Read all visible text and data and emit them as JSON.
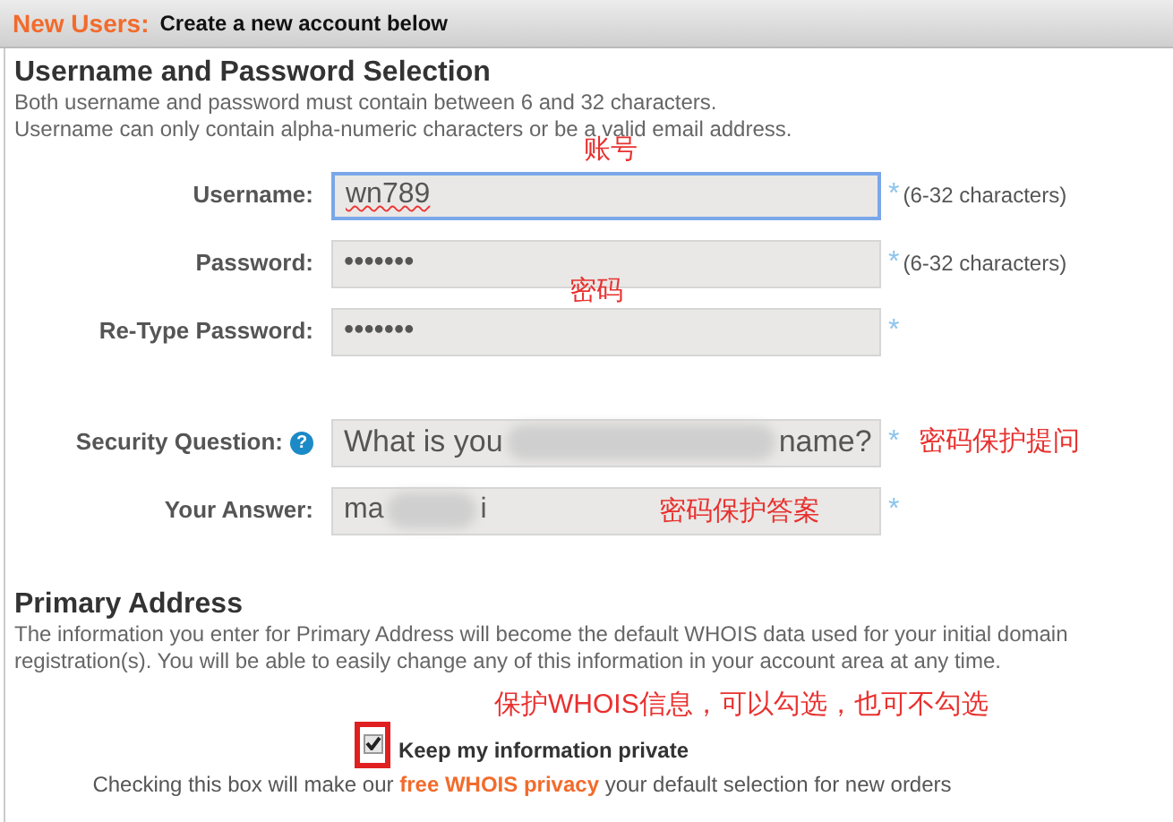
{
  "header": {
    "accent": "New Users:",
    "title": "Create a new account below"
  },
  "credentials": {
    "heading": "Username and Password Selection",
    "notes": [
      "Both username and password must contain between 6 and 32 characters.",
      "Username can only contain alpha-numeric characters or be a valid email address."
    ],
    "fields": [
      {
        "kind": "text",
        "label": "Username:",
        "value_parts": [
          "wn789"
        ],
        "focused": true,
        "required": "*",
        "hint": "(6-32 characters)",
        "annotation": "账号"
      },
      {
        "kind": "text",
        "label": "Password:",
        "value_parts": [
          "•••••••"
        ],
        "focused": false,
        "required": "*",
        "hint": "(6-32 characters)",
        "annotation": "密码"
      },
      {
        "kind": "text",
        "label": "Re-Type Password:",
        "value_parts": [
          "•••••••"
        ],
        "focused": false,
        "required": "*"
      },
      {
        "kind": "select",
        "label": "Security Question:",
        "help": "?",
        "value_parts": [
          "What is you",
          "name?"
        ],
        "focused": false,
        "required": "*",
        "annotation": "密码保护提问"
      },
      {
        "kind": "text",
        "label": "Your Answer:",
        "value_parts": [
          "ma",
          "i"
        ],
        "focused": false,
        "required": "*",
        "annotation": "密码保护答案"
      }
    ]
  },
  "address": {
    "heading": "Primary Address",
    "note": "The information you enter for Primary Address will become the default WHOIS data used for your initial domain registration(s). You will be able to easily change any of this information in your account area at any time.",
    "annotation": "保护WHOIS信息，可以勾选，也可不勾选",
    "privacy": {
      "checked": true,
      "label": "Keep my information private",
      "note_before": "Checking this box will make our",
      "link": "free WHOIS privacy",
      "note_after": "your default selection for new orders"
    }
  }
}
